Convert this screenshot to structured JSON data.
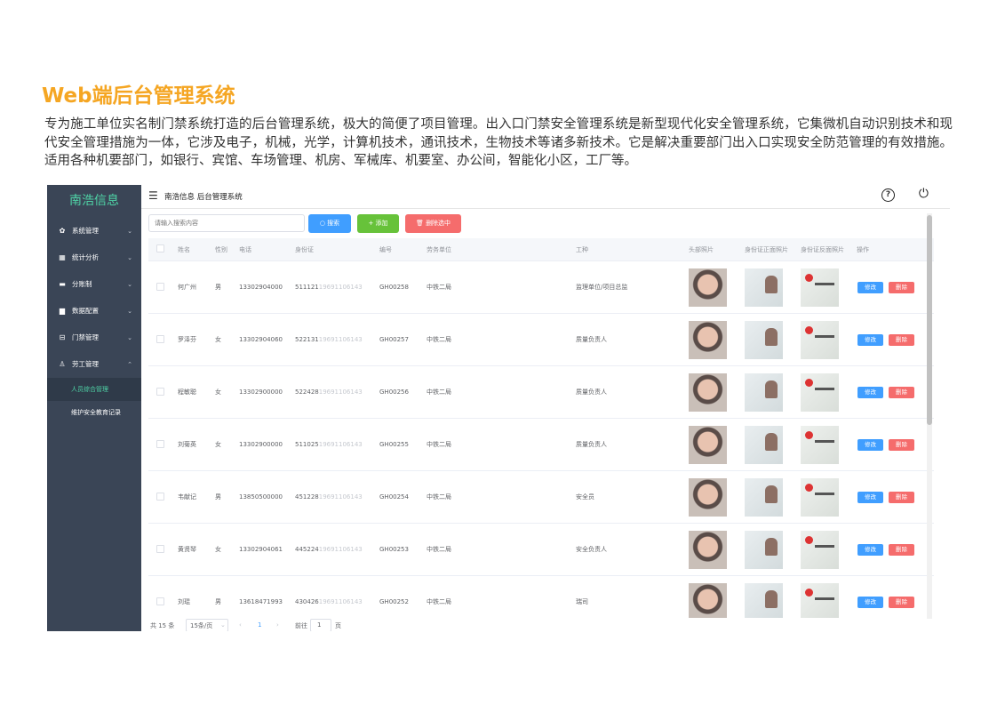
{
  "heading": "Web端后台管理系统",
  "intro": "专为施工单位实名制门禁系统打造的后台管理系统，极大的简便了项目管理。出入口门禁安全管理系统是新型现代化安全管理系统，它集微机自动识别技术和现代安全管理措施为一体，它涉及电子，机械，光学，计算机技术，通讯技术，生物技术等诸多新技术。它是解决重要部门出入口实现安全防范管理的有效措施。适用各种机要部门，如银行、宾馆、车场管理、机房、军械库、机要室、办公间，智能化小区，工厂等。",
  "sidebar": {
    "brand": "南浩信息",
    "items": [
      {
        "label": "系统管理",
        "icon": "gear-icon",
        "glyph": "✿",
        "chevron": "⌄"
      },
      {
        "label": "统计分析",
        "icon": "grid-icon",
        "glyph": "▦",
        "chevron": "⌄"
      },
      {
        "label": "分账制",
        "icon": "chat-icon",
        "glyph": "▬",
        "chevron": "⌄"
      },
      {
        "label": "数据配置",
        "icon": "folder-icon",
        "glyph": "▆",
        "chevron": "⌄"
      },
      {
        "label": "门禁管理",
        "icon": "door-icon",
        "glyph": "⊟",
        "chevron": "⌄"
      },
      {
        "label": "劳工管理",
        "icon": "user-icon",
        "glyph": "♙",
        "chevron": "⌃"
      }
    ],
    "subitems": [
      {
        "label": "人员综合管理",
        "active": true
      },
      {
        "label": "维护安全教育记录",
        "active": false
      }
    ]
  },
  "topbar": {
    "title": "南浩信息 后台管理系统",
    "menu_glyph": "☰",
    "help_glyph": "?",
    "power_glyph": "⏻"
  },
  "toolbar": {
    "search_placeholder": "请输入搜索内容",
    "search_label": "搜索",
    "search_glyph": "○",
    "add_label": "添加",
    "add_glyph": "+",
    "delete_selected_label": "删除选中",
    "delete_glyph": "🗑"
  },
  "table": {
    "headers": [
      "姓名",
      "性别",
      "电话",
      "身份证",
      "编号",
      "劳务单位",
      "工种",
      "头部照片",
      "身份证正面照片",
      "身份证反面照片",
      "操作"
    ],
    "edit_label": "修改",
    "delete_label": "删除",
    "rows": [
      {
        "name": "何广州",
        "gender": "男",
        "phone": "13302904000",
        "id_prefix": "511121",
        "id_rest": "19691106143",
        "code": "GH00258",
        "unit": "中铁二局",
        "job": "监理单位/项目总监"
      },
      {
        "name": "罗泽芬",
        "gender": "女",
        "phone": "13302904060",
        "id_prefix": "522131",
        "id_rest": "19691106143",
        "code": "GH00257",
        "unit": "中铁二局",
        "job": "质量负责人"
      },
      {
        "name": "程敏聪",
        "gender": "女",
        "phone": "13302900000",
        "id_prefix": "522428",
        "id_rest": "19691106143",
        "code": "GH00256",
        "unit": "中铁二局",
        "job": "质量负责人"
      },
      {
        "name": "刘菊英",
        "gender": "女",
        "phone": "13302900000",
        "id_prefix": "511025",
        "id_rest": "19691106143",
        "code": "GH00255",
        "unit": "中铁二局",
        "job": "质量负责人"
      },
      {
        "name": "韦献记",
        "gender": "男",
        "phone": "13850500000",
        "id_prefix": "451228",
        "id_rest": "19691106143",
        "code": "GH00254",
        "unit": "中铁二局",
        "job": "安全员"
      },
      {
        "name": "黄贤琴",
        "gender": "女",
        "phone": "13302904061",
        "id_prefix": "445224",
        "id_rest": "19691106143",
        "code": "GH00253",
        "unit": "中铁二局",
        "job": "安全负责人"
      },
      {
        "name": "刘琨",
        "gender": "男",
        "phone": "13618471993",
        "id_prefix": "430426",
        "id_rest": "19691106143",
        "code": "GH00252",
        "unit": "中铁二局",
        "job": "瑞司"
      }
    ]
  },
  "pager": {
    "total": "共 15 条",
    "page_size": "15条/页",
    "prev": "‹",
    "current": "1",
    "next": "›",
    "goto_label": "前往",
    "goto_value": "1",
    "page_suffix": "页"
  },
  "colors": {
    "accent_heading": "#f5a623",
    "sidebar_bg": "#3a4556",
    "brand": "#4fd3a6",
    "primary": "#409eff",
    "success": "#67c23a",
    "danger": "#f56c6c"
  }
}
